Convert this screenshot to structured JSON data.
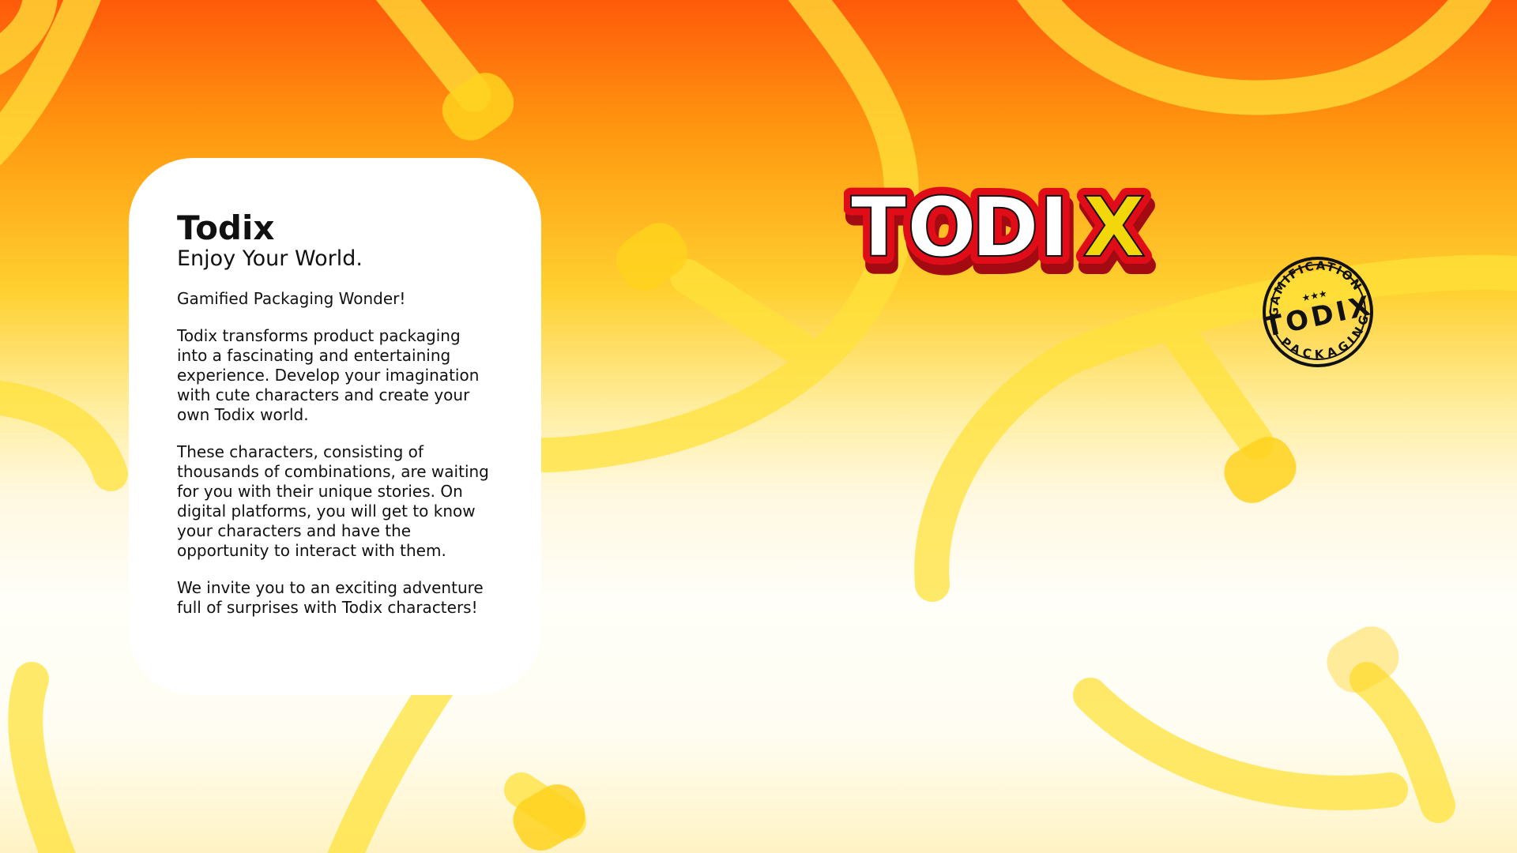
{
  "card": {
    "title": "Todix",
    "subtitle": "Enjoy Your World.",
    "tagline": "Gamified Packaging Wonder!",
    "paragraphs": [
      "Todix transforms product packaging into a fascinating and entertaining experience. Develop your imagination with cute characters and create your own Todix world.",
      "These characters, consisting of thousands of combinations, are waiting for you with their unique stories. On digital platforms, you will get to know your characters and have the opportunity to interact with them.",
      "We invite you to an exciting adventure full of surprises with Todix characters!"
    ]
  },
  "logo": {
    "wordmark": "TODIX",
    "letters": [
      "T",
      "O",
      "D",
      "I",
      "X"
    ],
    "colors": {
      "outline": "#e00d18",
      "shadow": "#a40a12",
      "fill": "#ffffff",
      "x_fill": "#f2d80a"
    }
  },
  "badge": {
    "top_text": "GAMIFICATION",
    "center_text": "TODIX",
    "bottom_text": "PACKAGING",
    "stars": "★★★",
    "color": "#111111"
  },
  "background": {
    "top_color": "#ff5a0a",
    "mid_color": "#ffd030",
    "bottom_color": "#fffef8",
    "swirl_color": "#ffe23a"
  }
}
